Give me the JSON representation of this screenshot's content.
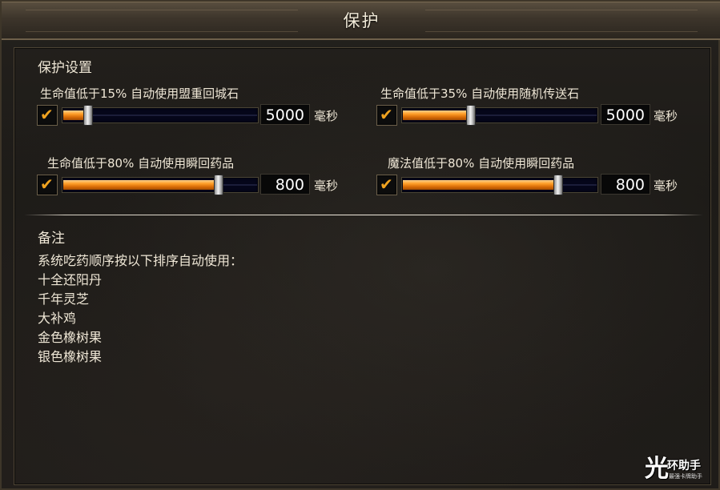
{
  "window": {
    "title": "保护"
  },
  "protection": {
    "section_title": "保护设置",
    "rows": [
      {
        "label": "生命值低于15% 自动使用盟重回城石",
        "checked": true,
        "value": "5000",
        "unit": "毫秒",
        "fill_fraction": 0.13
      },
      {
        "label": "生命值低于35% 自动使用随机传送石",
        "checked": true,
        "value": "5000",
        "unit": "毫秒",
        "fill_fraction": 0.35
      },
      {
        "label": "生命值低于80% 自动使用瞬回药品",
        "checked": true,
        "value": "800",
        "unit": "毫秒",
        "fill_fraction": 0.8
      },
      {
        "label": "魔法值低于80% 自动使用瞬回药品",
        "checked": true,
        "value": "800",
        "unit": "毫秒",
        "fill_fraction": 0.8
      }
    ]
  },
  "notes": {
    "title": "备注",
    "lines": [
      "系统吃药顺序按以下排序自动使用：",
      "十全还阳丹",
      "千年灵芝",
      "大补鸡",
      "金色橡树果",
      "银色橡树果"
    ]
  },
  "watermark": {
    "logo_glyph": "光",
    "name": "环助手",
    "tagline": "最强卡牌助手"
  },
  "colors": {
    "accent": "#f0a320",
    "slider_fill": "#ff9f2a",
    "track": "#05061a"
  }
}
